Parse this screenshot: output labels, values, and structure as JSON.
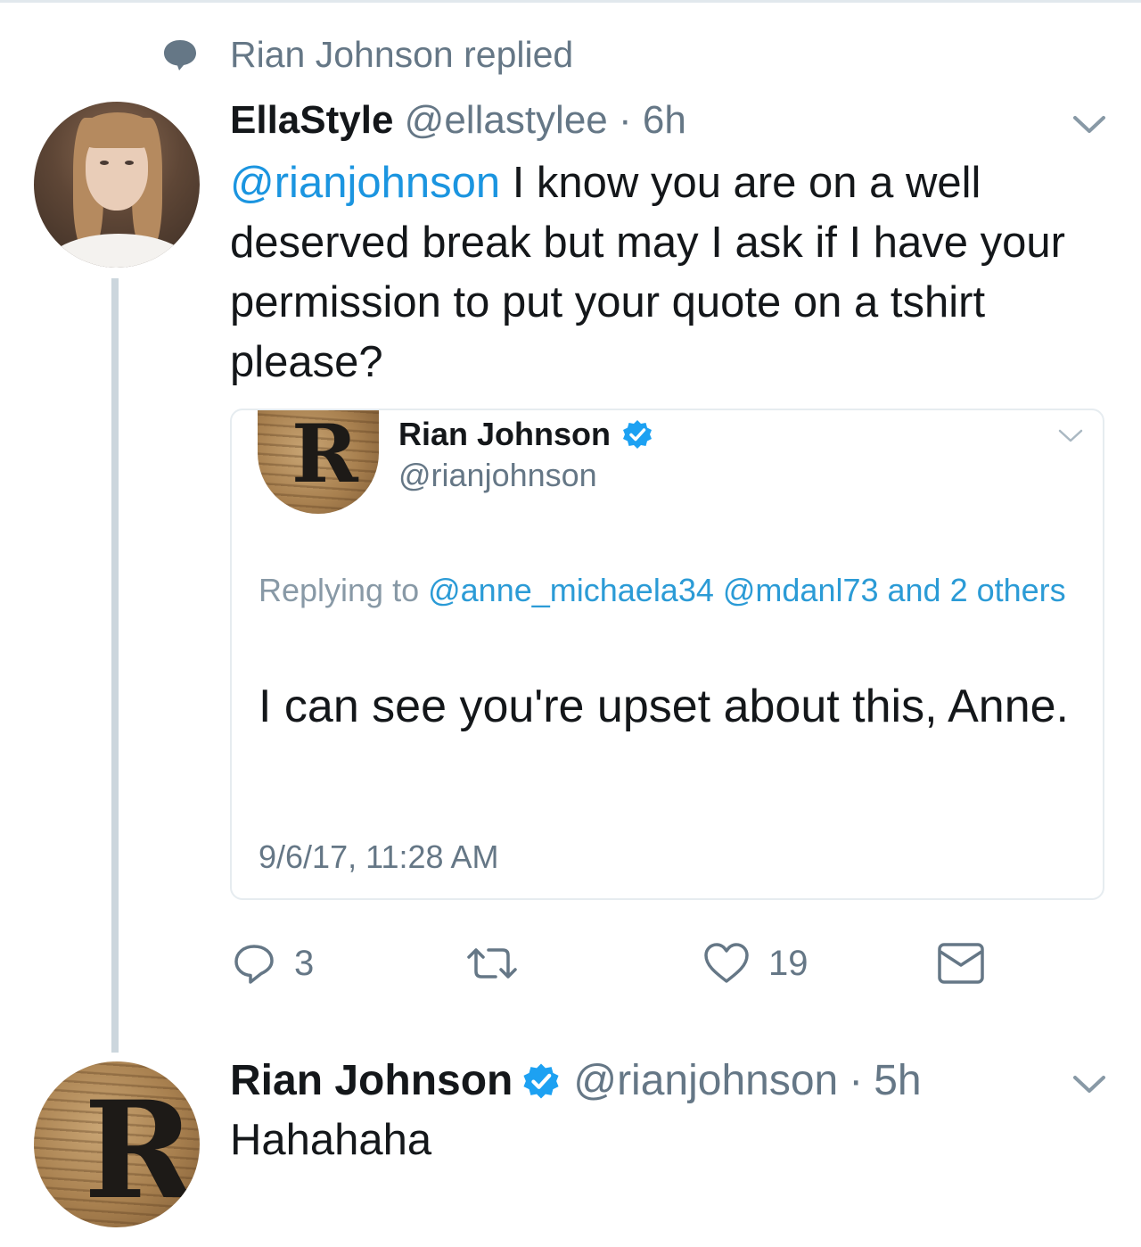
{
  "context": {
    "label": "Rian Johnson replied"
  },
  "tweet1": {
    "name": "EllaStyle",
    "handle": "@ellastylee",
    "time": "6h",
    "mention": "@rianjohnson",
    "text": " I know you are on a well deserved break but may I ask if I have your permission to put your quote on a tshirt please?"
  },
  "quoted": {
    "name": "Rian Johnson",
    "handle": "@rianjohnson",
    "replying_prefix": "Replying to ",
    "replying_users": "@anne_michaela34 @mdanl73 and 2 others",
    "text": "I can see you're upset about this, Anne.",
    "timestamp": "9/6/17, 11:28 AM",
    "avatar_letter": "R"
  },
  "actions": {
    "replies": "3",
    "likes": "19"
  },
  "tweet2": {
    "name": "Rian Johnson",
    "handle": "@rianjohnson",
    "time": "5h",
    "text": "Hahahaha",
    "avatar_letter": "R"
  },
  "colors": {
    "link": "#1b95e0",
    "muted": "#657786",
    "verified": "#1da1f2",
    "thread_line": "#ccd6dd"
  },
  "icons": [
    "speech-bubble-icon",
    "chevron-down-icon",
    "verified-badge-icon",
    "reply-icon",
    "retweet-icon",
    "heart-icon",
    "mail-icon"
  ]
}
